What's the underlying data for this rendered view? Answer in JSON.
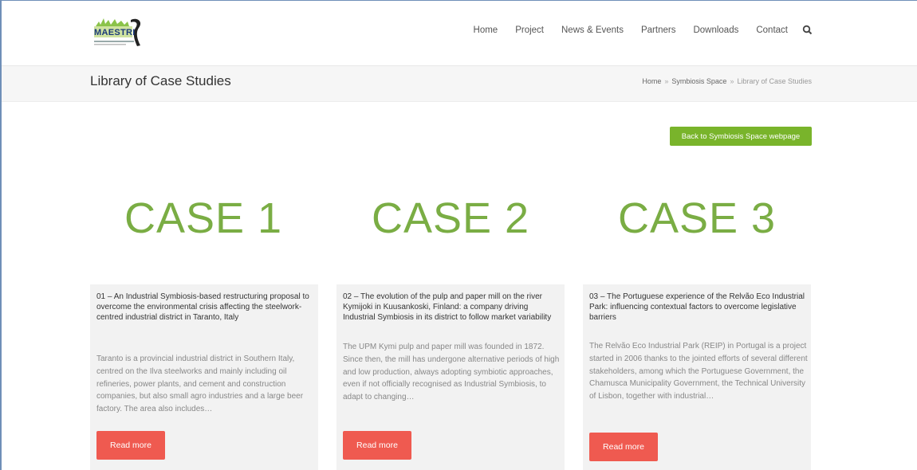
{
  "colors": {
    "accent_green": "#79b42b",
    "case_green": "#7aad44",
    "button_red": "#ef5a50",
    "nav_text": "#555555"
  },
  "logo": {
    "text": "MAESTRI",
    "icon": "maestri-logo"
  },
  "nav": {
    "items": [
      {
        "label": "Home"
      },
      {
        "label": "Project"
      },
      {
        "label": "News & Events"
      },
      {
        "label": "Partners"
      },
      {
        "label": "Downloads"
      },
      {
        "label": "Contact"
      }
    ],
    "search_icon": "search-icon"
  },
  "page": {
    "title": "Library of Case Studies",
    "breadcrumb": [
      {
        "label": "Home"
      },
      {
        "label": "Symbiosis Space"
      },
      {
        "label": "Library of Case Studies"
      }
    ],
    "breadcrumb_sep": "»",
    "back_button": "Back to Symbiosis Space webpage"
  },
  "cases": [
    {
      "heading": "CASE 1",
      "title": "01 – An Industrial Symbiosis-based restructuring proposal to overcome the environmental crisis affecting the steelwork-centred industrial district in Taranto, Italy",
      "excerpt": "Taranto is a provincial industrial district in Southern Italy, centred on the Ilva steelworks and mainly including oil refineries, power plants, and cement and construction companies, but also small agro industries and a large beer factory. The area also includes…",
      "button": "Read more"
    },
    {
      "heading": "CASE 2",
      "title": "02 – The evolution of the pulp and paper mill on the river Kymijoki in Kuusankoski, Finland: a company driving Industrial Symbiosis in its district to follow market variability",
      "excerpt": "The UPM Kymi pulp and paper mill was founded in 1872. Since then, the mill has undergone alternative periods of high and low production, always adopting symbiotic approaches, even if not officially recognised as Industrial Symbiosis, to adapt to changing…",
      "button": "Read more"
    },
    {
      "heading": "CASE 3",
      "title": "03 – The Portuguese experience of the Relvão Eco Industrial Park: influencing contextual factors to overcome legislative barriers",
      "excerpt": "The Relvão Eco Industrial Park (REIP) in Portugal is a project started in 2006 thanks to the jointed efforts of several different stakeholders, among which the Portuguese Government, the Chamusca Municipality Government, the Technical University of Lisbon, together with industrial…",
      "button": "Read more"
    }
  ]
}
